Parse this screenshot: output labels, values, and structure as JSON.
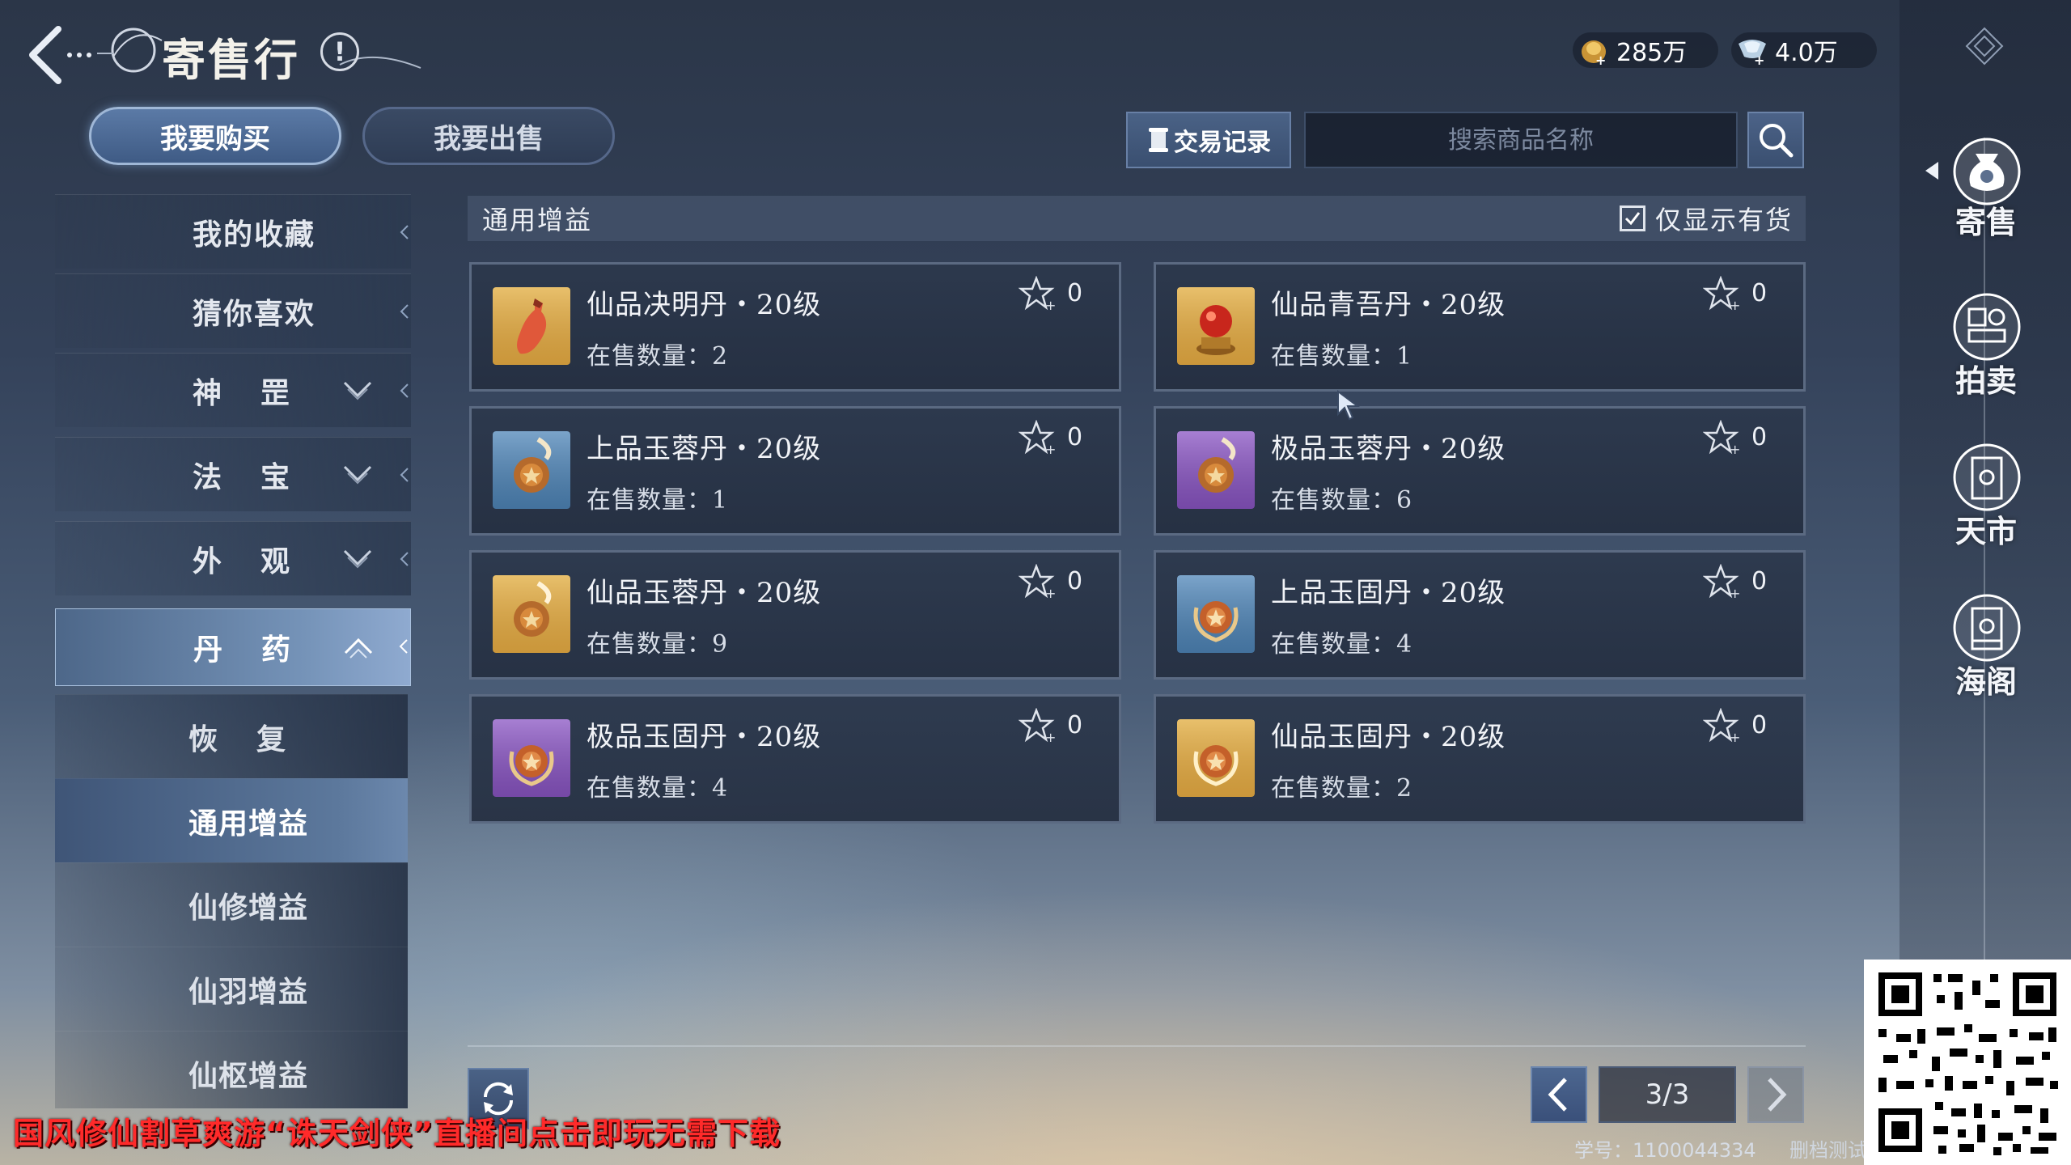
{
  "header": {
    "title": "寄售行",
    "info_icon_text": "!",
    "currency_gold": "285万",
    "currency_silver": "4.0万"
  },
  "tabs": {
    "buy": "我要购买",
    "sell": "我要出售"
  },
  "toolbar": {
    "trade_record": "交易记录",
    "search_placeholder": "搜索商品名称"
  },
  "sidebar": {
    "favorites": "我的收藏",
    "recommended": "猜你喜欢",
    "shenzhao": "神罡",
    "fabao": "法宝",
    "waiguan": "外观",
    "danyao": "丹药",
    "sub_huifu": "恢复",
    "sub_tongyong": "通用增益",
    "sub_xianxiu": "仙修增益",
    "sub_xianyu": "仙羽增益",
    "sub_xianshu": "仙枢增益"
  },
  "list": {
    "category_title": "通用增益",
    "stock_filter_label": "仅显示有货",
    "stock_filter_checked": true,
    "stock_prefix": "在售数量：",
    "items": [
      {
        "name": "仙品决明丹・20级",
        "stock": "在售数量：2",
        "fav": "0",
        "rarity": "gold",
        "icon": "vase-icon"
      },
      {
        "name": "仙品青吾丹・20级",
        "stock": "在售数量：1",
        "fav": "0",
        "rarity": "gold",
        "icon": "red-orb-icon"
      },
      {
        "name": "上品玉蓉丹・20级",
        "stock": "在售数量：1",
        "fav": "0",
        "rarity": "blue",
        "icon": "pill-icon"
      },
      {
        "name": "极品玉蓉丹・20级",
        "stock": "在售数量：6",
        "fav": "0",
        "rarity": "purple",
        "icon": "pill-icon"
      },
      {
        "name": "仙品玉蓉丹・20级",
        "stock": "在售数量：9",
        "fav": "0",
        "rarity": "gold",
        "icon": "pill-icon"
      },
      {
        "name": "上品玉固丹・20级",
        "stock": "在售数量：4",
        "fav": "0",
        "rarity": "blue",
        "icon": "pill-icon"
      },
      {
        "name": "极品玉固丹・20级",
        "stock": "在售数量：4",
        "fav": "0",
        "rarity": "purple",
        "icon": "pill-icon"
      },
      {
        "name": "仙品玉固丹・20级",
        "stock": "在售数量：2",
        "fav": "0",
        "rarity": "gold",
        "icon": "pill-icon"
      }
    ]
  },
  "pagination": {
    "indicator": "3/3"
  },
  "rail": {
    "consign": "寄售",
    "auction": "拍卖",
    "tianshi": "天市",
    "haige": "海阁"
  },
  "overlay": {
    "promo": "国风修仙割草爽游“诛天剑侠”直播间点击即玩无需下载",
    "student_id": "学号：1100044334",
    "debug": "删档测试"
  },
  "colors": {
    "rarity_gold": "#d9a441",
    "rarity_blue": "#4f86b9",
    "rarity_purple": "#8a55c4",
    "promo_red": "#ff2a2a"
  }
}
